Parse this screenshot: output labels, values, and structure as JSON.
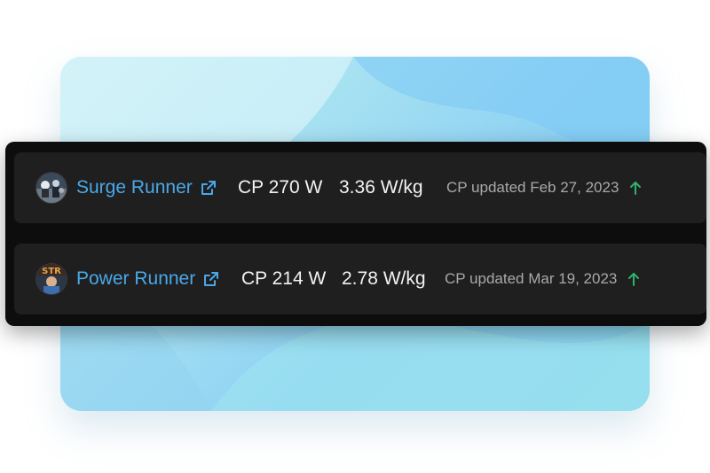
{
  "colors": {
    "link": "#4aa8e8",
    "up_arrow": "#2fb36b",
    "panel": "#0d0d0e",
    "row": "#1f1f20"
  },
  "athletes": [
    {
      "name": "Surge Runner",
      "link_icon": "external-link-icon",
      "cp": "CP 270 W",
      "wkg": "3.36 W/kg",
      "updated": "CP updated Feb 27, 2023",
      "trend_icon": "arrow-up-icon"
    },
    {
      "name": "Power Runner",
      "link_icon": "external-link-icon",
      "cp": "CP 214 W",
      "wkg": "2.78 W/kg",
      "updated": "CP updated Mar 19, 2023",
      "trend_icon": "arrow-up-icon"
    }
  ]
}
